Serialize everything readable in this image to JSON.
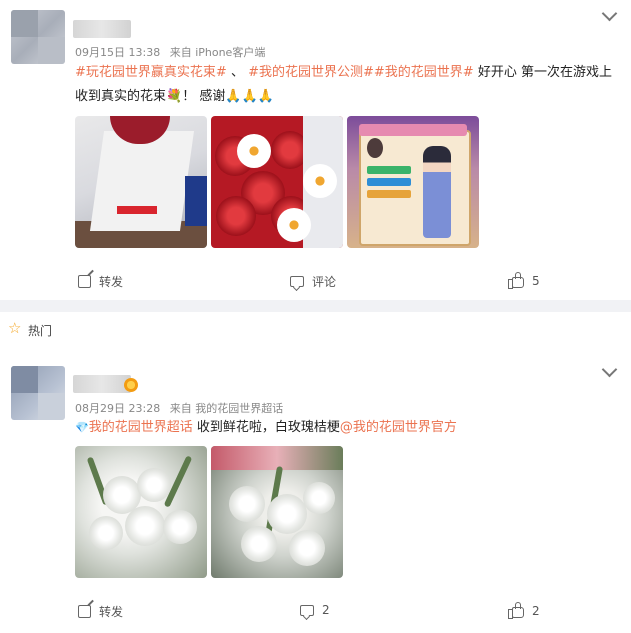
{
  "colors": {
    "accent": "#eb7350",
    "badge": "#f39c12",
    "hot_star": "#f5a623"
  },
  "post1": {
    "meta": {
      "date": "09月15日 13:38",
      "source": "来自 iPhone客户端"
    },
    "content": {
      "tag1": "#玩花园世界赢真实花束#",
      "sep": "、",
      "tag2": "#我的花园世界公测#",
      "tag3": "#我的花园世界#",
      "text1": "好开心 第一次在游戏上收到真实的花束",
      "emoji1": "💐",
      "text2": "！ 感谢",
      "emoji2": "🙏🙏🙏"
    },
    "actions": {
      "repost": "转发",
      "comment": "评论",
      "like_count": "5"
    },
    "icons": [
      "chevron-down-icon",
      "repost-icon",
      "comment-icon",
      "like-icon"
    ]
  },
  "section": {
    "label": "热门",
    "icon": "star-icon"
  },
  "post2": {
    "meta": {
      "date": "08月29日 23:28",
      "source": "来自 我的花园世界超话"
    },
    "content": {
      "supertopic_icon": "💎",
      "supertopic": "我的花园世界超话",
      "text1": " 收到鲜花啦，白玫瑰桔梗",
      "mention": "@我的花园世界官方"
    },
    "actions": {
      "repost": "转发",
      "comment_count": "2",
      "like_count": "2"
    },
    "icons": [
      "chevron-down-icon",
      "repost-icon",
      "comment-icon",
      "like-icon",
      "vip-badge-icon"
    ]
  }
}
